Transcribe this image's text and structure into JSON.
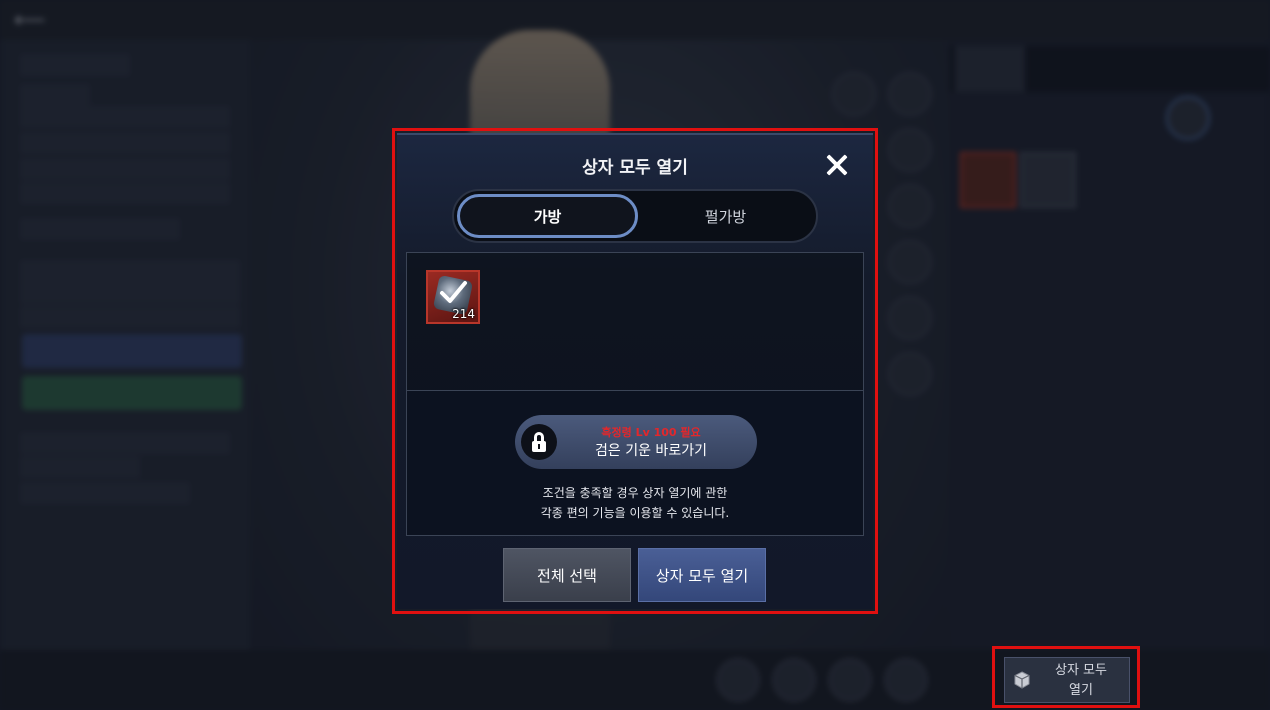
{
  "modal": {
    "title": "상자 모두 열기",
    "tabs": [
      {
        "label": "가방",
        "active": true
      },
      {
        "label": "펄가방",
        "active": false
      }
    ],
    "item": {
      "count": "214",
      "checked": true
    },
    "lock_button": {
      "requirement": "흑정령 Lv 100 필요",
      "label": "검은 기운 바로가기"
    },
    "description": "조건을 충족할 경우 상자 열기에 관한\n각종 편의 기능을 이용할 수 있습니다.",
    "buttons": {
      "select_all": "전체 선택",
      "open_all": "상자 모두 열기"
    }
  },
  "side_button": {
    "label": "상자 모두\n열기",
    "icon": "box-icon"
  },
  "colors": {
    "highlight": "#e01010",
    "accent_tab": "#6d8dc6",
    "requirement_red": "#e3272b"
  }
}
